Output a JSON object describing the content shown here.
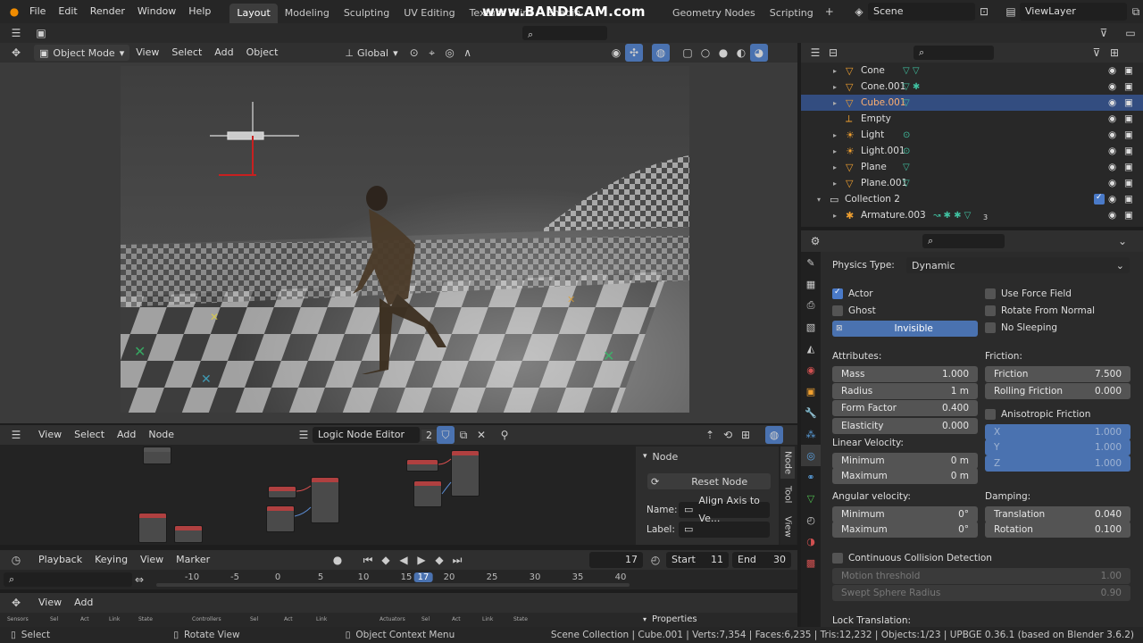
{
  "topbar": {
    "menus": [
      "File",
      "Edit",
      "Render",
      "Window",
      "Help"
    ],
    "tabs": [
      "Layout",
      "Modeling",
      "Sculpting",
      "UV Editing",
      "Texture Paint",
      "Shadin"
    ],
    "tabs_right": [
      "Geometry Nodes",
      "Scripting"
    ],
    "active_tab": "Layout",
    "watermark": "www.BANDICAM.com",
    "scene": "Scene",
    "view_layer": "ViewLayer"
  },
  "viewport_header": {
    "mode": "Object Mode",
    "menus": [
      "View",
      "Select",
      "Add",
      "Object"
    ],
    "transform": "Global"
  },
  "outliner": {
    "rows": [
      {
        "name": "Cone",
        "icon": "cone-icon",
        "selected": false
      },
      {
        "name": "Cone.001",
        "icon": "cone-icon",
        "selected": false
      },
      {
        "name": "Cube.001",
        "icon": "cube-icon",
        "selected": true
      },
      {
        "name": "Empty",
        "icon": "empty-icon",
        "selected": false
      },
      {
        "name": "Light",
        "icon": "light-icon",
        "selected": false
      },
      {
        "name": "Light.001",
        "icon": "light-icon",
        "selected": false
      },
      {
        "name": "Plane",
        "icon": "plane-icon",
        "selected": false
      },
      {
        "name": "Plane.001",
        "icon": "plane-icon",
        "selected": false
      },
      {
        "name": "Collection 2",
        "icon": "collection-icon",
        "selected": false
      },
      {
        "name": "Armature.003",
        "icon": "armature-icon",
        "selected": false
      }
    ],
    "subscript": "3"
  },
  "physics": {
    "type_label": "Physics Type:",
    "type_value": "Dynamic",
    "actor": "Actor",
    "ghost": "Ghost",
    "invisible": "Invisible",
    "use_force_field": "Use Force Field",
    "rotate_from_normal": "Rotate From Normal",
    "no_sleeping": "No Sleeping",
    "attributes": "Attributes:",
    "mass_label": "Mass",
    "mass": "1.000",
    "radius_label": "Radius",
    "radius": "1 m",
    "form_factor_label": "Form Factor",
    "form_factor": "0.400",
    "elasticity_label": "Elasticity",
    "elasticity": "0.000",
    "friction_hdr": "Friction:",
    "friction_label": "Friction",
    "friction": "7.500",
    "rolling_friction_label": "Rolling Friction",
    "rolling_friction": "0.000",
    "anisotropic": "Anisotropic Friction",
    "x_label": "X",
    "x": "1.000",
    "y_label": "Y",
    "y": "1.000",
    "z_label": "Z",
    "z": "1.000",
    "linear_velocity": "Linear Velocity:",
    "lv_min_label": "Minimum",
    "lv_min": "0 m",
    "lv_max_label": "Maximum",
    "lv_max": "0 m",
    "angular_velocity": "Angular velocity:",
    "av_min_label": "Minimum",
    "av_min": "0°",
    "av_max_label": "Maximum",
    "av_max": "0°",
    "damping": "Damping:",
    "translation_label": "Translation",
    "translation": "0.040",
    "rotation_label": "Rotation",
    "rotation": "0.100",
    "ccd": "Continuous Collision Detection",
    "motion_threshold_label": "Motion threshold",
    "motion_threshold": "1.00",
    "swept_label": "Swept Sphere Radius",
    "swept": "0.90",
    "lock_translation": "Lock Translation:"
  },
  "node_editor": {
    "menus": [
      "View",
      "Select",
      "Add",
      "Node"
    ],
    "editor_name": "Logic Node Editor",
    "users": "2",
    "panel_title": "Node",
    "reset_node": "Reset Node",
    "name_label": "Name:",
    "name_value": "Align Axis to Ve...",
    "label_label": "Label:",
    "side_tabs": [
      "Node",
      "Tool",
      "View"
    ]
  },
  "timeline": {
    "menus": [
      "Playback",
      "Keying",
      "View",
      "Marker"
    ],
    "current_frame": "17",
    "start_label": "Start",
    "start": "11",
    "end_label": "End",
    "end": "30",
    "ticks": [
      "-10",
      "-5",
      "0",
      "5",
      "10",
      "15",
      "17",
      "20",
      "25",
      "30",
      "35",
      "40"
    ]
  },
  "logic_editor": {
    "menus": [
      "View",
      "Add"
    ],
    "columns": [
      "Sensors",
      "Sel",
      "Act",
      "Link",
      "State",
      "Controllers",
      "Sel",
      "Act",
      "Link",
      "Actuators",
      "Sel",
      "Act",
      "Link",
      "State"
    ],
    "properties": "Properties"
  },
  "status": {
    "select": "Select",
    "rotate": "Rotate View",
    "context": "Object Context Menu",
    "info": "Scene Collection | Cube.001 | Verts:7,354 | Faces:6,235 | Tris:12,232 | Objects:1/23 | UPBGE 0.36.1 (based on Blender 3.6.2)"
  }
}
